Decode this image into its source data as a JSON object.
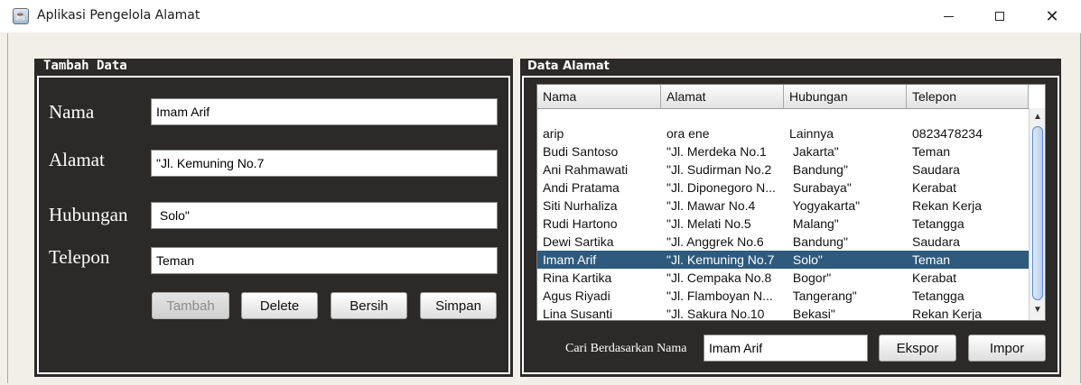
{
  "window": {
    "title": "Aplikasi Pengelola Alamat",
    "icon": "java-cup-icon"
  },
  "form": {
    "panel_title": "Tambah Data",
    "nama_label": "Nama",
    "nama_value": "Imam Arif",
    "alamat_label": "Alamat",
    "alamat_value": "\"Jl. Kemuning No.7",
    "hubungan_label": "Hubungan",
    "hubungan_value": " Solo\"",
    "telepon_label": "Telepon",
    "telepon_value": "Teman",
    "buttons": {
      "tambah": "Tambah",
      "delete": "Delete",
      "bersih": "Bersih",
      "simpan": "Simpan"
    }
  },
  "table": {
    "panel_title": "Data Alamat",
    "columns": [
      "Nama",
      "Alamat",
      "Hubungan",
      "Telepon"
    ],
    "rows": [
      [
        "arip",
        "ora ene",
        "Lainnya",
        "0823478234"
      ],
      [
        "Budi Santoso",
        "\"Jl. Merdeka No.1",
        " Jakarta\"",
        "Teman"
      ],
      [
        "Ani Rahmawati",
        "\"Jl. Sudirman No.2",
        " Bandung\"",
        "Saudara"
      ],
      [
        "Andi Pratama",
        "\"Jl. Diponegoro N...",
        " Surabaya\"",
        "Kerabat"
      ],
      [
        "Siti Nurhaliza",
        "\"Jl. Mawar No.4",
        " Yogyakarta\"",
        "Rekan Kerja"
      ],
      [
        "Rudi Hartono",
        "\"Jl. Melati No.5",
        " Malang\"",
        "Tetangga"
      ],
      [
        "Dewi Sartika",
        "\"Jl. Anggrek No.6",
        " Bandung\"",
        "Saudara"
      ],
      [
        "Imam Arif",
        "\"Jl. Kemuning No.7",
        " Solo\"",
        "Teman"
      ],
      [
        "Rina Kartika",
        "\"Jl. Cempaka No.8",
        " Bogor\"",
        "Kerabat"
      ],
      [
        "Agus Riyadi",
        "\"Jl. Flamboyan N...",
        " Tangerang\"",
        "Tetangga"
      ],
      [
        "Lina Susanti",
        "\"Jl. Sakura No.10",
        " Bekasi\"",
        "Rekan Kerja"
      ]
    ],
    "selected_row": 7
  },
  "search": {
    "label": "Cari Berdasarkan Nama",
    "value": "Imam Arif",
    "ekspor": "Ekspor",
    "impor": "Impor"
  },
  "colors": {
    "panel_bg": "#2b2a29",
    "window_bg": "#f2efe8",
    "selection": "#2e5a7e"
  }
}
